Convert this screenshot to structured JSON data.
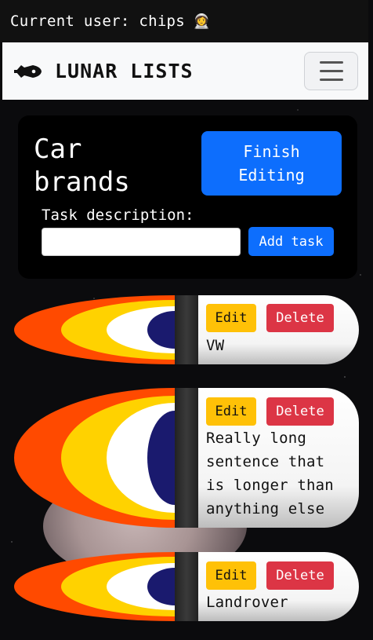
{
  "user_bar": {
    "text": "Current user: chips",
    "emoji": "👩‍🚀"
  },
  "navbar": {
    "brand": "LUNAR LISTS",
    "rocket_icon": "rocket-icon",
    "menu_icon": "hamburger-menu-icon"
  },
  "editor": {
    "title": "Car brands",
    "finish_label": "Finish Editing",
    "task_label": "Task description:",
    "task_value": "",
    "add_label": "Add task"
  },
  "tasks": [
    {
      "text": "VW",
      "edit_label": "Edit",
      "delete_label": "Delete"
    },
    {
      "text": "Really long sentence that is longer than anything else",
      "edit_label": "Edit",
      "delete_label": "Delete"
    },
    {
      "text": "Landrover",
      "edit_label": "Edit",
      "delete_label": "Delete"
    }
  ],
  "colors": {
    "primary": "#0d6efd",
    "warning": "#ffc107",
    "danger": "#dc3545",
    "flame_outer": "#ff4a00",
    "flame_mid": "#ffd200",
    "flame_inner": "#ffffff",
    "flame_core": "#1a1a6e"
  }
}
